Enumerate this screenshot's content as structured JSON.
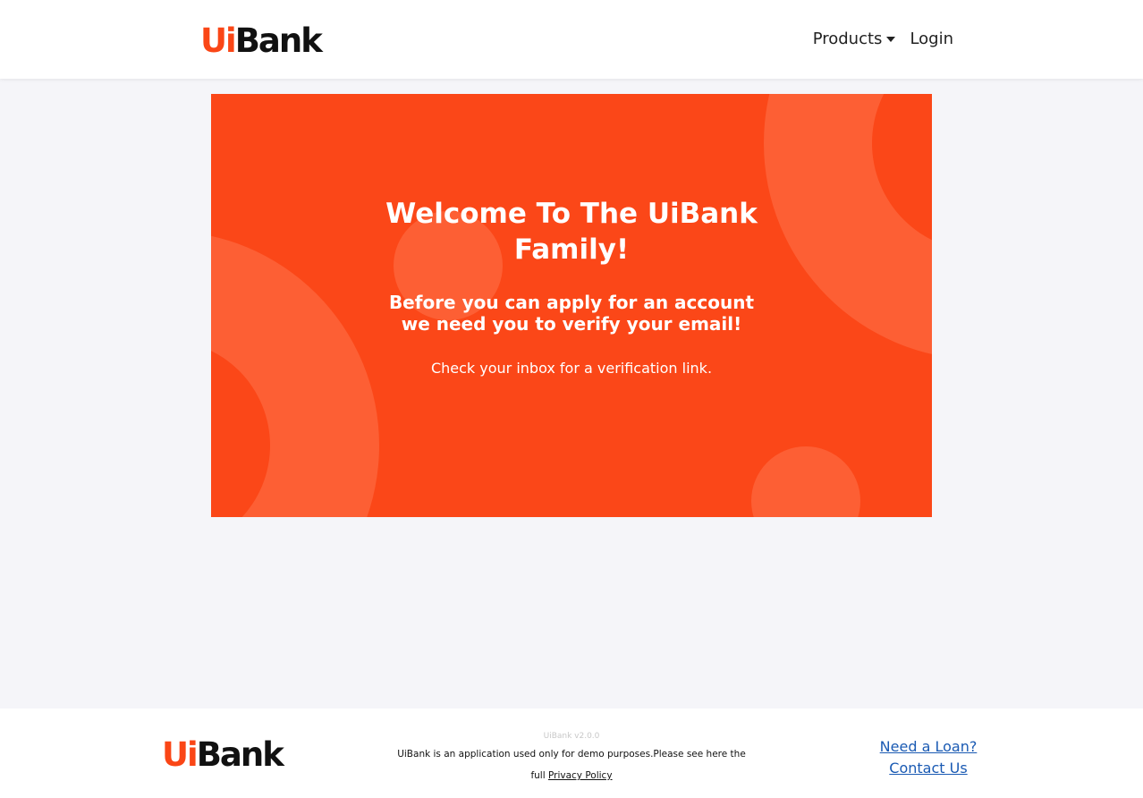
{
  "brand": {
    "logo_ui": "Ui",
    "logo_bank": "Bank",
    "accent_color": "#fa4616"
  },
  "nav": {
    "products_label": "Products",
    "login_label": "Login"
  },
  "hero": {
    "title": "Welcome To The UiBank Family!",
    "subtitle": "Before you can apply for an account we need you to verify your email!",
    "note": "Check your inbox for a verification link.",
    "background_color": "#fb4718",
    "decor_color": "#fd5f34"
  },
  "footer": {
    "version": "UiBank v2.0.0",
    "description_prefix": "UiBank is an application used only for demo purposes.Please see here the full",
    "privacy_link_label": "Privacy Policy",
    "loan_link_label": "Need a Loan?",
    "contact_link_label": "Contact Us",
    "link_color": "#1a5ab3"
  }
}
